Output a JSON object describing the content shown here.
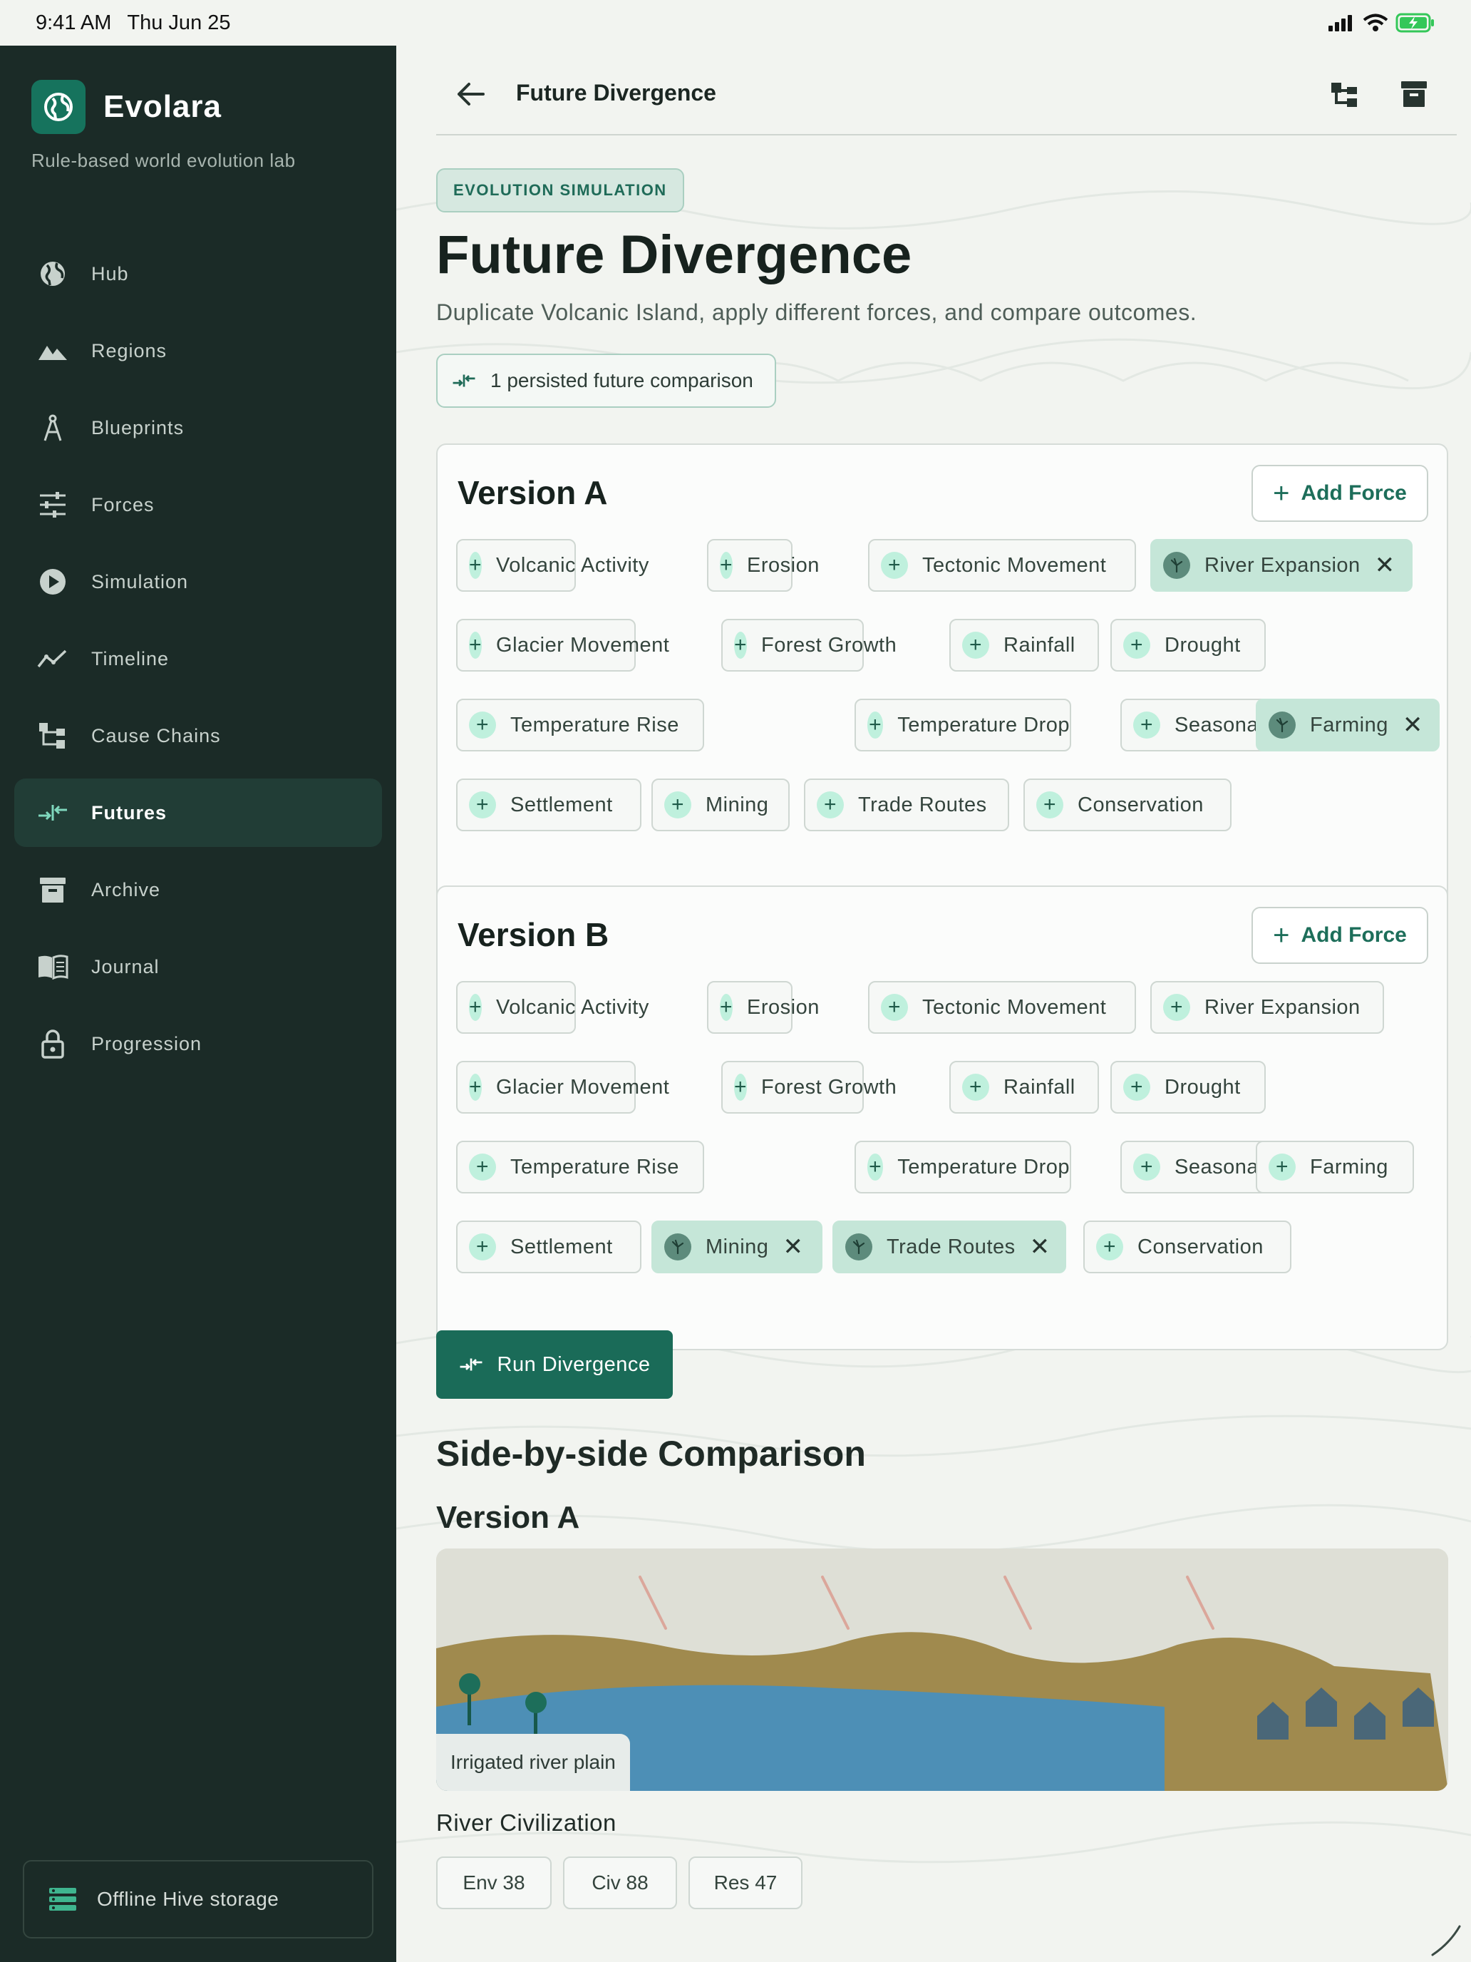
{
  "status_bar": {
    "time": "9:41 AM",
    "date": "Thu Jun 25"
  },
  "app": {
    "name": "Evolara",
    "tagline": "Rule-based world evolution lab"
  },
  "sidebar": {
    "items": [
      {
        "label": "Hub",
        "icon": "globe-icon",
        "active": false
      },
      {
        "label": "Regions",
        "icon": "mountain-icon",
        "active": false
      },
      {
        "label": "Blueprints",
        "icon": "compass-icon",
        "active": false
      },
      {
        "label": "Forces",
        "icon": "sliders-icon",
        "active": false
      },
      {
        "label": "Simulation",
        "icon": "play-icon",
        "active": false
      },
      {
        "label": "Timeline",
        "icon": "timeline-icon",
        "active": false
      },
      {
        "label": "Cause Chains",
        "icon": "hierarchy-icon",
        "active": false
      },
      {
        "label": "Futures",
        "icon": "diverge-icon",
        "active": true
      },
      {
        "label": "Archive",
        "icon": "archive-icon",
        "active": false
      },
      {
        "label": "Journal",
        "icon": "book-icon",
        "active": false
      },
      {
        "label": "Progression",
        "icon": "lock-icon",
        "active": false
      }
    ],
    "storage_label": "Offline Hive storage"
  },
  "topbar": {
    "title": "Future Divergence"
  },
  "header": {
    "badge": "EVOLUTION SIMULATION",
    "title": "Future Divergence",
    "subtitle": "Duplicate Volcanic Island, apply different forces, and compare outcomes.",
    "persisted": "1 persisted future comparison"
  },
  "versions": [
    {
      "title": "Version A",
      "add_label": "Add Force",
      "forces": [
        {
          "label": "Volcanic Activity",
          "selected": false
        },
        {
          "label": "Erosion",
          "selected": false
        },
        {
          "label": "Tectonic Movement",
          "selected": false
        },
        {
          "label": "River Expansion",
          "selected": true
        },
        {
          "label": "Glacier Movement",
          "selected": false
        },
        {
          "label": "Forest Growth",
          "selected": false
        },
        {
          "label": "Rainfall",
          "selected": false
        },
        {
          "label": "Drought",
          "selected": false
        },
        {
          "label": "Temperature Rise",
          "selected": false
        },
        {
          "label": "Temperature Drop",
          "selected": false
        },
        {
          "label": "Seasonal Shift",
          "selected": false
        },
        {
          "label": "Farming",
          "selected": true
        },
        {
          "label": "Settlement",
          "selected": false
        },
        {
          "label": "Mining",
          "selected": false
        },
        {
          "label": "Trade Routes",
          "selected": false
        },
        {
          "label": "Conservation",
          "selected": false
        }
      ]
    },
    {
      "title": "Version B",
      "add_label": "Add Force",
      "forces": [
        {
          "label": "Volcanic Activity",
          "selected": false
        },
        {
          "label": "Erosion",
          "selected": false
        },
        {
          "label": "Tectonic Movement",
          "selected": false
        },
        {
          "label": "River Expansion",
          "selected": false
        },
        {
          "label": "Glacier Movement",
          "selected": false
        },
        {
          "label": "Forest Growth",
          "selected": false
        },
        {
          "label": "Rainfall",
          "selected": false
        },
        {
          "label": "Drought",
          "selected": false
        },
        {
          "label": "Temperature Rise",
          "selected": false
        },
        {
          "label": "Temperature Drop",
          "selected": false
        },
        {
          "label": "Seasonal Shift",
          "selected": false
        },
        {
          "label": "Farming",
          "selected": false
        },
        {
          "label": "Settlement",
          "selected": false
        },
        {
          "label": "Mining",
          "selected": true
        },
        {
          "label": "Trade Routes",
          "selected": true
        },
        {
          "label": "Conservation",
          "selected": false
        }
      ]
    }
  ],
  "run_label": "Run Divergence",
  "comparison": {
    "heading": "Side-by-side Comparison",
    "version_heading": "Version A",
    "scene_label": "Irrigated river plain",
    "civ_name": "River Civilization",
    "stats": [
      "Env 38",
      "Civ 88",
      "Res 47"
    ]
  },
  "colors": {
    "sidebar_bg": "#1b2b27",
    "accent": "#1a6b58",
    "chip_icon": "#bff0dd",
    "chip_selected": "#c5e6d8"
  }
}
